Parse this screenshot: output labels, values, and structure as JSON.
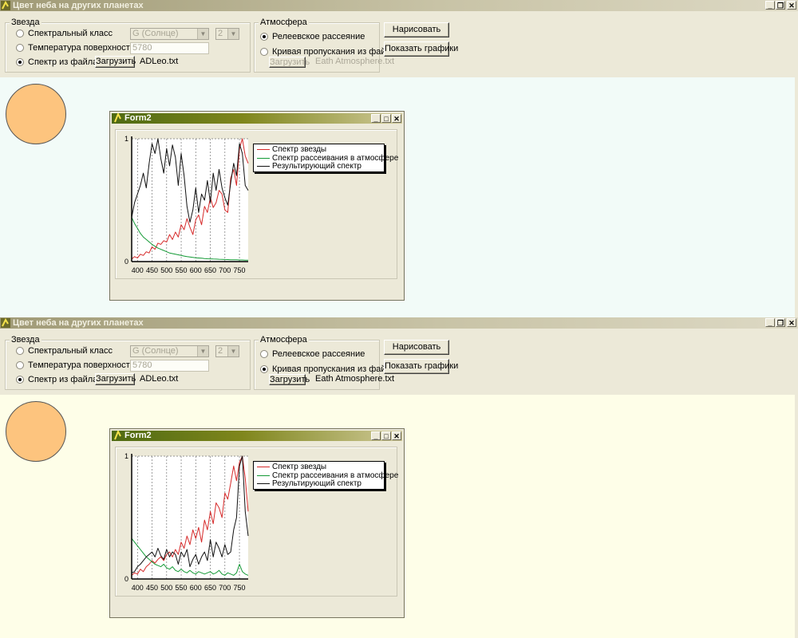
{
  "colors": {
    "star": "#d62a2a",
    "scatter": "#139a35",
    "result": "#111111",
    "canvas_top": "#f2fbf8",
    "canvas_bottom": "#fefee8",
    "sun": "#fdc47e"
  },
  "windows": [
    {
      "title": "Цвет неба на других планетах",
      "star_group": {
        "label": "Звезда",
        "radio_spectral_class": {
          "label": "Спектральный класс",
          "selected": false
        },
        "radio_temperature": {
          "label": "Температура поверхности",
          "selected": false
        },
        "radio_file": {
          "label": "Спектр из файла",
          "selected": true
        },
        "class_combo_value": "G (Солнце)",
        "subclass_combo_value": "2",
        "temperature_value": "5780",
        "load_button": "Загрузить",
        "file_name": "ADLeo.txt"
      },
      "atmosphere_group": {
        "label": "Атмосфера",
        "radio_rayleigh": {
          "label": "Релеевское рассеяние",
          "selected": true
        },
        "radio_curve": {
          "label": "Кривая пропускания из файла",
          "selected": false
        },
        "load_button": "Загрузить",
        "file_name": "Eath Atmosphere.txt"
      },
      "draw_button": "Нарисовать",
      "show_charts_button": "Показать графики",
      "form2": {
        "title": "Form2",
        "legend": [
          "Спектр звезды",
          "Спектр рассеивания в атмосфере",
          "Результирующий спектр"
        ],
        "chart_data": {
          "type": "line",
          "x": [
            380,
            390,
            400,
            410,
            420,
            430,
            440,
            450,
            460,
            470,
            480,
            490,
            500,
            510,
            520,
            530,
            540,
            550,
            560,
            570,
            580,
            590,
            600,
            610,
            620,
            630,
            640,
            650,
            660,
            670,
            680,
            690,
            700,
            710,
            720,
            730,
            740,
            750,
            760,
            770,
            780
          ],
          "xticks": [
            "400",
            "450",
            "500",
            "550",
            "600",
            "650",
            "700",
            "750"
          ],
          "yticks": [
            "0",
            "1"
          ],
          "ylim": [
            0,
            1
          ],
          "xlim": [
            380,
            780
          ],
          "grid": true,
          "series": [
            {
              "name": "Спектр звезды",
              "values": [
                0.02,
                0.04,
                0.03,
                0.06,
                0.05,
                0.08,
                0.07,
                0.12,
                0.1,
                0.15,
                0.14,
                0.17,
                0.16,
                0.22,
                0.18,
                0.24,
                0.2,
                0.3,
                0.26,
                0.35,
                0.28,
                0.22,
                0.34,
                0.38,
                0.3,
                0.45,
                0.4,
                0.52,
                0.44,
                0.48,
                0.58,
                0.55,
                0.42,
                0.4,
                0.68,
                0.75,
                0.62,
                0.92,
                1.0,
                0.86,
                0.8
              ]
            },
            {
              "name": "Спектр рассеивания в атмосфере",
              "values": [
                0.36,
                0.31,
                0.27,
                0.23,
                0.2,
                0.18,
                0.16,
                0.14,
                0.125,
                0.11,
                0.1,
                0.09,
                0.08,
                0.07,
                0.065,
                0.06,
                0.055,
                0.05,
                0.045,
                0.04,
                0.037,
                0.034,
                0.031,
                0.029,
                0.027,
                0.025,
                0.023,
                0.022,
                0.021,
                0.02,
                0.019,
                0.018,
                0.017,
                0.016,
                0.015,
                0.015,
                0.014,
                0.013,
                0.013,
                0.012,
                0.012
              ]
            },
            {
              "name": "Результирующий спектр",
              "values": [
                0.36,
                0.48,
                0.55,
                0.62,
                0.72,
                0.6,
                0.8,
                0.96,
                0.88,
                1.0,
                0.84,
                0.72,
                0.92,
                0.78,
                0.95,
                0.85,
                0.62,
                0.88,
                0.7,
                0.45,
                0.32,
                0.42,
                0.6,
                0.4,
                0.55,
                0.5,
                0.66,
                0.48,
                0.72,
                0.58,
                0.75,
                0.6,
                0.52,
                0.46,
                0.64,
                0.8,
                0.7,
                0.96,
                0.88,
                0.62,
                0.58
              ]
            }
          ]
        }
      }
    },
    {
      "title": "Цвет неба на других планетах",
      "star_group": {
        "label": "Звезда",
        "radio_spectral_class": {
          "label": "Спектральный класс",
          "selected": false
        },
        "radio_temperature": {
          "label": "Температура поверхности",
          "selected": false
        },
        "radio_file": {
          "label": "Спектр из файла",
          "selected": true
        },
        "class_combo_value": "G (Солнце)",
        "subclass_combo_value": "2",
        "temperature_value": "5780",
        "load_button": "Загрузить",
        "file_name": "ADLeo.txt"
      },
      "atmosphere_group": {
        "label": "Атмосфера",
        "radio_rayleigh": {
          "label": "Релеевское рассеяние",
          "selected": false
        },
        "radio_curve": {
          "label": "Кривая пропускания из файла",
          "selected": true
        },
        "load_button": "Загрузить",
        "file_name": "Eath Atmosphere.txt"
      },
      "draw_button": "Нарисовать",
      "show_charts_button": "Показать графики",
      "form2": {
        "title": "Form2",
        "legend": [
          "Спектр звезды",
          "Спектр рассеивания в атмосфере",
          "Результирующий спектр"
        ],
        "chart_data": {
          "type": "line",
          "x": [
            380,
            390,
            400,
            410,
            420,
            430,
            440,
            450,
            460,
            470,
            480,
            490,
            500,
            510,
            520,
            530,
            540,
            550,
            560,
            570,
            580,
            590,
            600,
            610,
            620,
            630,
            640,
            650,
            660,
            670,
            680,
            690,
            700,
            710,
            720,
            730,
            740,
            750,
            760,
            770,
            780
          ],
          "xticks": [
            "400",
            "450",
            "500",
            "550",
            "600",
            "650",
            "700",
            "750"
          ],
          "yticks": [
            "0",
            "1"
          ],
          "ylim": [
            0,
            1
          ],
          "xlim": [
            380,
            780
          ],
          "grid": true,
          "series": [
            {
              "name": "Спектр звезды",
              "values": [
                0.03,
                0.05,
                0.04,
                0.08,
                0.06,
                0.1,
                0.12,
                0.15,
                0.13,
                0.16,
                0.18,
                0.15,
                0.2,
                0.22,
                0.18,
                0.24,
                0.2,
                0.3,
                0.25,
                0.35,
                0.28,
                0.4,
                0.33,
                0.42,
                0.3,
                0.48,
                0.4,
                0.55,
                0.45,
                0.62,
                0.58,
                0.5,
                0.7,
                0.65,
                0.78,
                0.92,
                0.8,
                0.95,
                1.0,
                0.82,
                0.55
              ]
            },
            {
              "name": "Спектр рассеивания в атмосфере",
              "values": [
                0.33,
                0.3,
                0.27,
                0.24,
                0.21,
                0.18,
                0.16,
                0.14,
                0.12,
                0.11,
                0.1,
                0.12,
                0.09,
                0.08,
                0.1,
                0.07,
                0.06,
                0.08,
                0.06,
                0.05,
                0.07,
                0.05,
                0.04,
                0.06,
                0.05,
                0.04,
                0.05,
                0.06,
                0.04,
                0.05,
                0.07,
                0.04,
                0.03,
                0.05,
                0.04,
                0.03,
                0.05,
                0.12,
                0.06,
                0.04,
                0.03
              ]
            },
            {
              "name": "Результирующий спектр",
              "values": [
                0.05,
                0.06,
                0.1,
                0.12,
                0.15,
                0.18,
                0.2,
                0.22,
                0.18,
                0.25,
                0.19,
                0.16,
                0.24,
                0.18,
                0.22,
                0.2,
                0.12,
                0.22,
                0.18,
                0.24,
                0.1,
                0.16,
                0.2,
                0.12,
                0.18,
                0.22,
                0.15,
                0.32,
                0.18,
                0.3,
                0.25,
                0.18,
                0.28,
                0.2,
                0.22,
                0.4,
                0.5,
                0.92,
                1.0,
                0.55,
                0.35
              ]
            }
          ]
        }
      }
    }
  ]
}
